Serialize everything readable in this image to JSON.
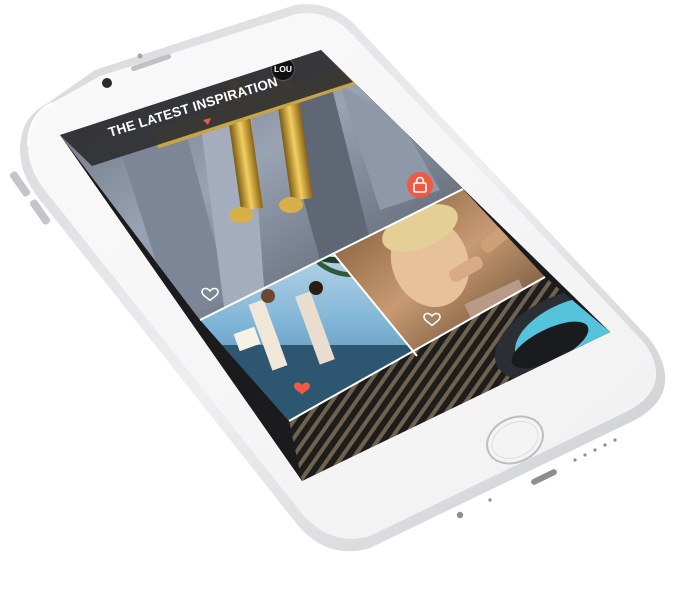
{
  "header": {
    "title": "THE LATEST INSPIRATION",
    "avatar_initials": "LOU"
  },
  "feed": {
    "tiles": [
      {
        "name": "zipper-bag",
        "liked": false
      },
      {
        "name": "beach-couple",
        "liked": true
      },
      {
        "name": "makeup-portrait",
        "liked": false
      },
      {
        "name": "striped-blue-circle",
        "liked": false
      }
    ]
  },
  "icons": {
    "bag": "shopping-bag-icon",
    "heart": "heart-icon",
    "heart_filled": "heart-filled-icon"
  },
  "colors": {
    "device_body": "#e9eaec",
    "screen_bezel": "#f7f7f8",
    "header_bg": "#2f2f33",
    "accent": "#f05a44",
    "liked_heart": "#f05a44"
  }
}
